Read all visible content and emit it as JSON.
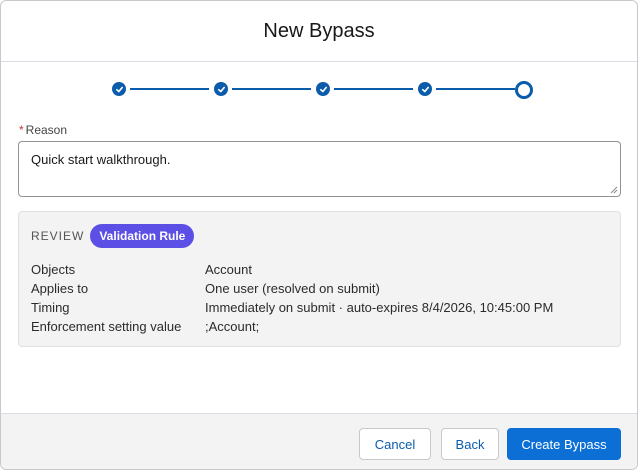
{
  "modal": {
    "title": "New Bypass"
  },
  "stepper": {
    "completed_steps": 4,
    "total_steps": 5,
    "accent_color": "#0b5cab"
  },
  "reason": {
    "label": "Reason",
    "required_marker": "*",
    "value": "Quick start walkthrough."
  },
  "review": {
    "title": "REVIEW",
    "badge": "Validation Rule",
    "badge_color": "#5b4fe6",
    "rows": [
      {
        "label": "Objects",
        "value": "Account"
      },
      {
        "label": "Applies to",
        "value": "One user (resolved on submit)"
      },
      {
        "label": "Timing",
        "value": "Immediately on submit · auto-expires 8/4/2026, 10:45:00 PM"
      },
      {
        "label": "Enforcement setting value",
        "value": ";Account;"
      }
    ]
  },
  "footer": {
    "cancel_label": "Cancel",
    "back_label": "Back",
    "create_label": "Create Bypass",
    "brand_color": "#0b6fd6"
  }
}
